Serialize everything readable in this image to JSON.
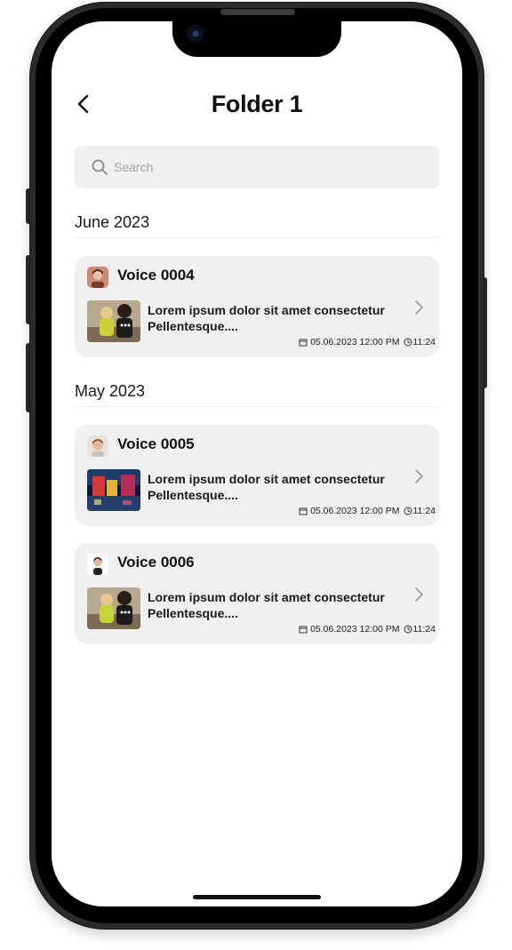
{
  "header": {
    "title": "Folder 1",
    "back_icon": "chevron-left-icon"
  },
  "search": {
    "placeholder": "Search",
    "icon": "search-icon"
  },
  "sections": [
    {
      "heading": "June 2023",
      "items": [
        {
          "title": "Voice 0004",
          "description_line1": "Lorem ipsum dolor sit amet consectetur",
          "description_line2": "Pellentesque....",
          "date_time": "05.06.2023 12:00 PM",
          "duration": "11:24"
        }
      ]
    },
    {
      "heading": "May 2023",
      "items": [
        {
          "title": "Voice 0005",
          "description_line1": "Lorem ipsum dolor sit amet consectetur",
          "description_line2": "Pellentesque....",
          "date_time": "05.06.2023 12:00 PM",
          "duration": "11:24"
        },
        {
          "title": "Voice 0006",
          "description_line1": "Lorem ipsum dolor sit amet consectetur",
          "description_line2": "Pellentesque....",
          "date_time": "05.06.2023 12:00 PM",
          "duration": "11:24"
        }
      ]
    }
  ],
  "colors": {
    "card_bg": "#f0f0f0",
    "text": "#111111",
    "frame": "#2b2b2d"
  }
}
